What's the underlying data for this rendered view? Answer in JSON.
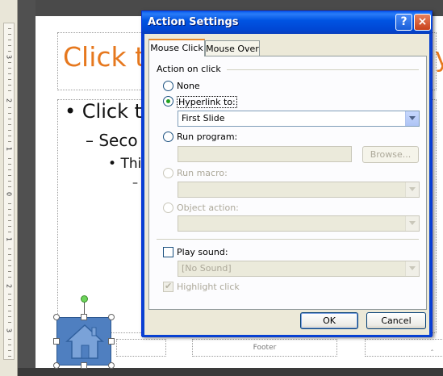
{
  "slide": {
    "title": "Click t",
    "title_tail": "yl",
    "bullet1": "Click t",
    "bullet2": "Seco",
    "bullet3": "Thi",
    "bullet4": "–",
    "footer_label": "Footer",
    "footer_right": "‸"
  },
  "ruler": {
    "numbers": [
      "3",
      "2",
      "1",
      "0",
      "1",
      "2",
      "3"
    ]
  },
  "dialog": {
    "title": "Action Settings",
    "help_symbol": "?",
    "close_symbol": "×",
    "tabs": [
      {
        "label": "Mouse Click",
        "active": true
      },
      {
        "label": "Mouse Over",
        "active": false
      }
    ],
    "group_label": "Action on click",
    "options": {
      "none": "None",
      "hyperlink_to": "Hyperlink to:",
      "run_program": "Run program:",
      "run_macro": "Run macro:",
      "object_action": "Object action:"
    },
    "selected_option": "hyperlink_to",
    "hyperlink_value": "First Slide",
    "browse_label": "Browse...",
    "play_sound_label": "Play sound:",
    "sound_value": "[No Sound]",
    "highlight_click_label": "Highlight click",
    "ok_label": "OK",
    "cancel_label": "Cancel"
  },
  "colors": {
    "title_orange": "#e6781e",
    "titlebar_blue": "#0054e3",
    "dialog_bg": "#ece9d8",
    "shape_fill": "#4f7fc0"
  }
}
